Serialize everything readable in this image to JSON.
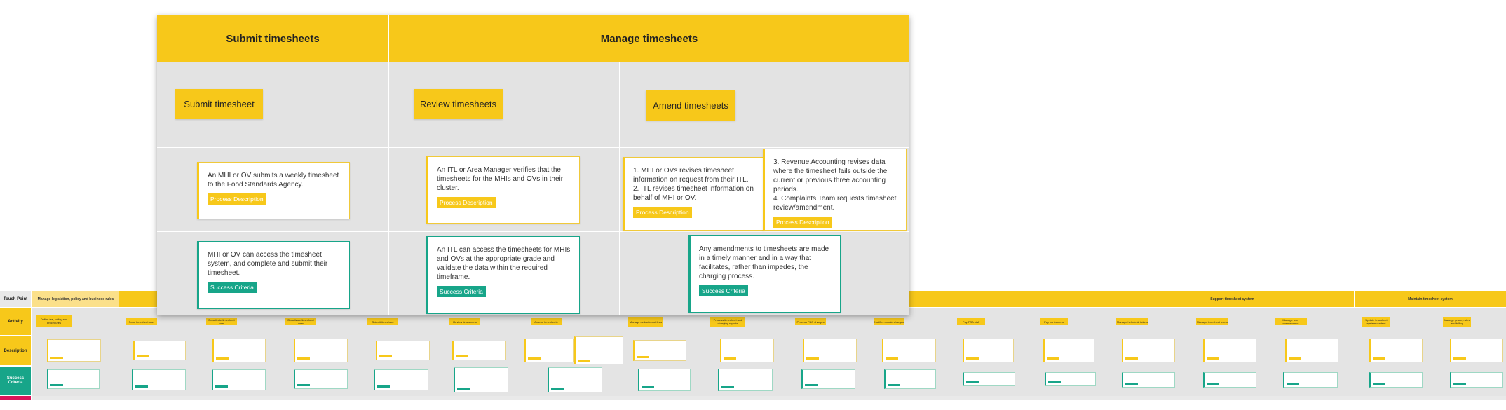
{
  "background_board": {
    "row_labels": [
      "Touch Point",
      "Activity",
      "Description",
      "Success Criteria"
    ],
    "first_header": "Manage legislation, policy and business rules",
    "section_headers": [
      "Support timesheet system",
      "Maintain timesheet system"
    ],
    "first_activity": "Define fee, policy and procedures",
    "activities": [
      "Send timesheet user",
      "Deactivate timesheet user",
      "Deactivate timesheet user",
      "Submit timesheet",
      "Review timesheets",
      "Amend timesheets",
      "Manage deduction of fees",
      "Process timesheet and charging reports",
      "Process FBO charges",
      "Notifies unpaid charges",
      "Pay FSA staff",
      "Pay contractors",
      "Manage helpdesk tickets",
      "Manage timesheet users",
      "Manage user maintenance",
      "Update timesheet system content",
      "Manage grade, rates and billing"
    ]
  },
  "overlay": {
    "headers": {
      "submit": "Submit timesheets",
      "manage": "Manage timesheets"
    },
    "activities": {
      "submit": "Submit timesheet",
      "review": "Review timesheets",
      "amend": "Amend timesheets"
    },
    "descriptions": {
      "submit": "An MHI or OV submits a weekly timesheet to the Food Standards Agency.",
      "review": "An ITL or Area Manager verifies that the timesheets for the MHIs and OVs in their cluster.",
      "amend_1": "1. MHI or OVs revises timesheet information on request from their ITL.\n2. ITL revises timesheet information on behalf of MHI or OV.",
      "amend_2": "3. Revenue Accounting revises data where the timesheet fails outside the current or previous three accounting periods.\n4. Complaints Team requests timesheet review/amendment."
    },
    "success": {
      "submit": "MHI or OV can access the timesheet system, and complete and submit their timesheet.",
      "review": "An ITL can access the timesheets for MHIs and OVs at the appropriate grade and validate the data within the required timeframe.",
      "amend": "Any amendments to timesheets are made in a timely manner and in a way that facilitates, rather than impedes, the charging process."
    },
    "labels": {
      "process_description": "Process Description",
      "success_criteria": "Success Criteria"
    }
  },
  "colors": {
    "accent_yellow": "#f7c81a",
    "accent_green": "#17a589",
    "panel_gray": "#e3e3e3"
  }
}
